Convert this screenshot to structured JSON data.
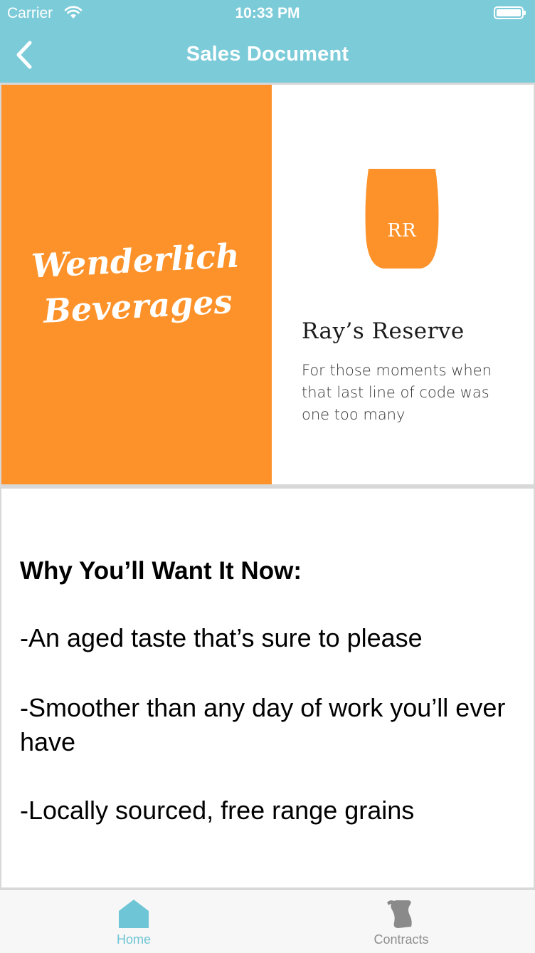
{
  "status_bar": {
    "carrier": "Carrier",
    "time": "10:33 PM",
    "icons": [
      "wifi-icon",
      "battery-icon"
    ]
  },
  "nav": {
    "title": "Sales Document",
    "back_icon": "chevron-left-icon"
  },
  "brand": {
    "logo_text": "Wenderlich Beverages",
    "color": "#fd922a"
  },
  "product": {
    "glass_monogram": "RR",
    "name": "Ray’s Reserve",
    "tagline": "For those moments when that last line of code was one too many"
  },
  "pitch": {
    "heading": "Why You’ll Want It Now:",
    "benefits": [
      "-An aged taste that’s sure to please",
      "-Smoother than any day of work you’ll ever have",
      "-Locally sourced, free range grains"
    ]
  },
  "tab_bar": {
    "tabs": [
      {
        "label": "Home",
        "icon": "home-icon",
        "selected": true
      },
      {
        "label": "Contracts",
        "icon": "scroll-icon",
        "selected": false
      }
    ]
  },
  "colors": {
    "header": "#7ccbd9",
    "accent": "#fd922a",
    "tab_selected": "#6ec5d5",
    "tab_unselected": "#8e8e8e"
  }
}
